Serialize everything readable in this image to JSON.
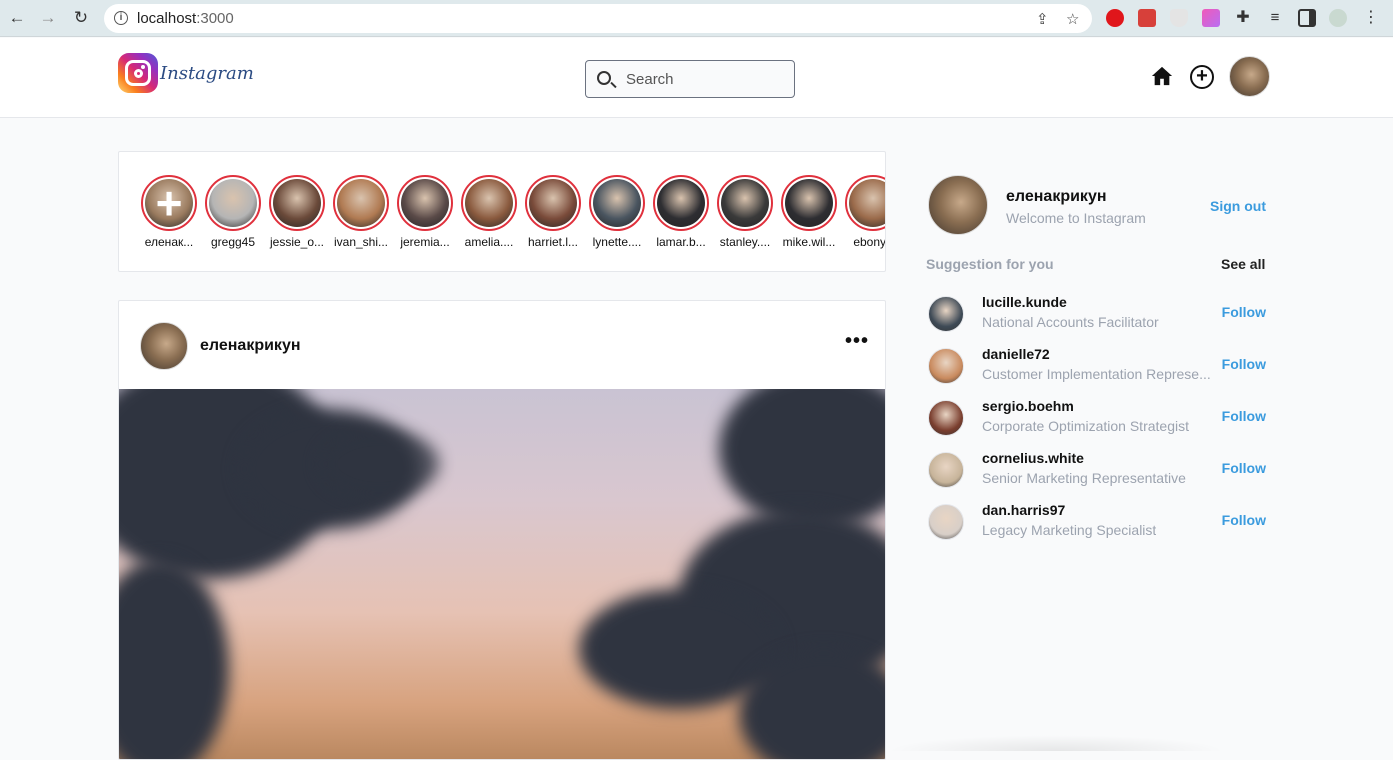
{
  "browser": {
    "url_host": "localhost",
    "url_port": ":3000",
    "nav": {
      "back": "←",
      "forward": "→",
      "reload": "↻"
    },
    "icons": [
      "info-icon",
      "share-icon",
      "bookmark-star-icon",
      "opera-icon",
      "extension-red-icon",
      "shield-icon",
      "gradient-extension-icon",
      "puzzle-icon",
      "media-icon",
      "side-panel-icon",
      "profile-icon",
      "menu-icon"
    ]
  },
  "header": {
    "brand": "Instagram",
    "search_placeholder": "Search"
  },
  "stories": [
    {
      "name": "еленак...",
      "color": "#9a7b5f",
      "is_add": true
    },
    {
      "name": "gregg45",
      "color": "#b5b5b5"
    },
    {
      "name": "jessie_o...",
      "color": "#6b4a3a"
    },
    {
      "name": "ivan_shi...",
      "color": "#b07a52"
    },
    {
      "name": "jeremia...",
      "color": "#5a4a48"
    },
    {
      "name": "amelia....",
      "color": "#8a5a3e"
    },
    {
      "name": "harriet.l...",
      "color": "#7a4b3a"
    },
    {
      "name": "lynette....",
      "color": "#4a5560"
    },
    {
      "name": "lamar.b...",
      "color": "#2e2e32"
    },
    {
      "name": "stanley....",
      "color": "#3a3a3a"
    },
    {
      "name": "mike.wil...",
      "color": "#2e2e32"
    },
    {
      "name": "ebony_",
      "color": "#9a6a4a"
    }
  ],
  "post": {
    "username": "еленакрикун",
    "more": "•••"
  },
  "sidebar": {
    "username": "еленакрикун",
    "welcome": "Welcome to Instagram",
    "sign_out": "Sign out",
    "suggestion_title": "Suggestion for you",
    "see_all": "See all",
    "suggestions": [
      {
        "username": "lucille.kunde",
        "role": "National Accounts Facilitator",
        "follow": "Follow",
        "color": "#3e4a56"
      },
      {
        "username": "danielle72",
        "role": "Customer Implementation Represe...",
        "follow": "Follow",
        "color": "#c98a5e"
      },
      {
        "username": "sergio.boehm",
        "role": "Corporate Optimization Strategist",
        "follow": "Follow",
        "color": "#7a3e2e"
      },
      {
        "username": "cornelius.white",
        "role": "Senior Marketing Representative",
        "follow": "Follow",
        "color": "#c7b49a"
      },
      {
        "username": "dan.harris97",
        "role": "Legacy Marketing Specialist",
        "follow": "Follow",
        "color": "#d8cfc8"
      }
    ]
  },
  "colors": {
    "link": "#3b9bde",
    "story_ring": "#e0313d",
    "muted": "#9ca3af"
  }
}
